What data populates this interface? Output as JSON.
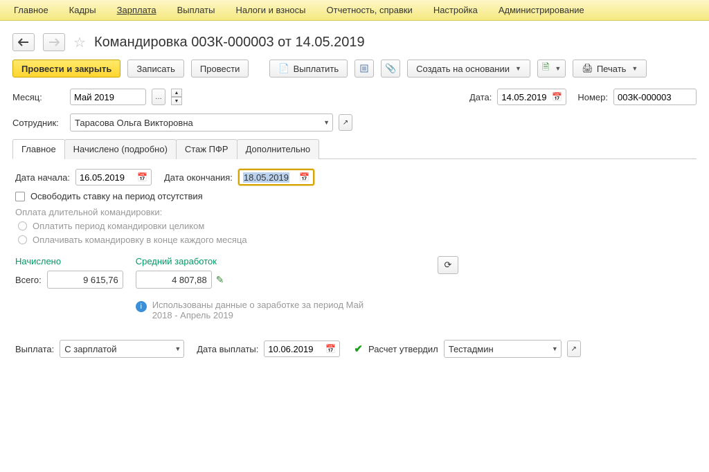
{
  "menu": [
    "Главное",
    "Кадры",
    "Зарплата",
    "Выплаты",
    "Налоги и взносы",
    "Отчетность, справки",
    "Настройка",
    "Администрирование"
  ],
  "menu_active_index": 2,
  "title": "Командировка 00ЗК-000003 от 14.05.2019",
  "toolbar": {
    "post_close": "Провести и закрыть",
    "save": "Записать",
    "post": "Провести",
    "pay": "Выплатить",
    "create_on": "Создать на основании",
    "print": "Печать"
  },
  "fields": {
    "month_label": "Месяц:",
    "month_value": "Май 2019",
    "date_label": "Дата:",
    "date_value": "14.05.2019",
    "number_label": "Номер:",
    "number_value": "00ЗК-000003",
    "employee_label": "Сотрудник:",
    "employee_value": "Тарасова Ольга Викторовна"
  },
  "tabs": [
    "Главное",
    "Начислено (подробно)",
    "Стаж ПФР",
    "Дополнительно"
  ],
  "tabs_active_index": 0,
  "main": {
    "start_label": "Дата начала:",
    "start_value": "16.05.2019",
    "end_label": "Дата окончания:",
    "end_value": "18.05.2019",
    "release_rate": "Освободить ставку на период отсутствия",
    "long_trip_header": "Оплата длительной командировки:",
    "opt_whole": "Оплатить период командировки целиком",
    "opt_monthly": "Оплачивать командировку в конце каждого месяца",
    "accrued_label": "Начислено",
    "avg_label": "Средний заработок",
    "total_label": "Всего:",
    "total_value": "9 615,76",
    "avg_value": "4 807,88",
    "info_text": "Использованы данные о заработке за период Май 2018 - Апрель 2019"
  },
  "bottom": {
    "payout_label": "Выплата:",
    "payout_value": "С зарплатой",
    "paydate_label": "Дата выплаты:",
    "paydate_value": "10.06.2019",
    "approved_label": "Расчет утвердил",
    "approver_value": "Тестадмин"
  }
}
